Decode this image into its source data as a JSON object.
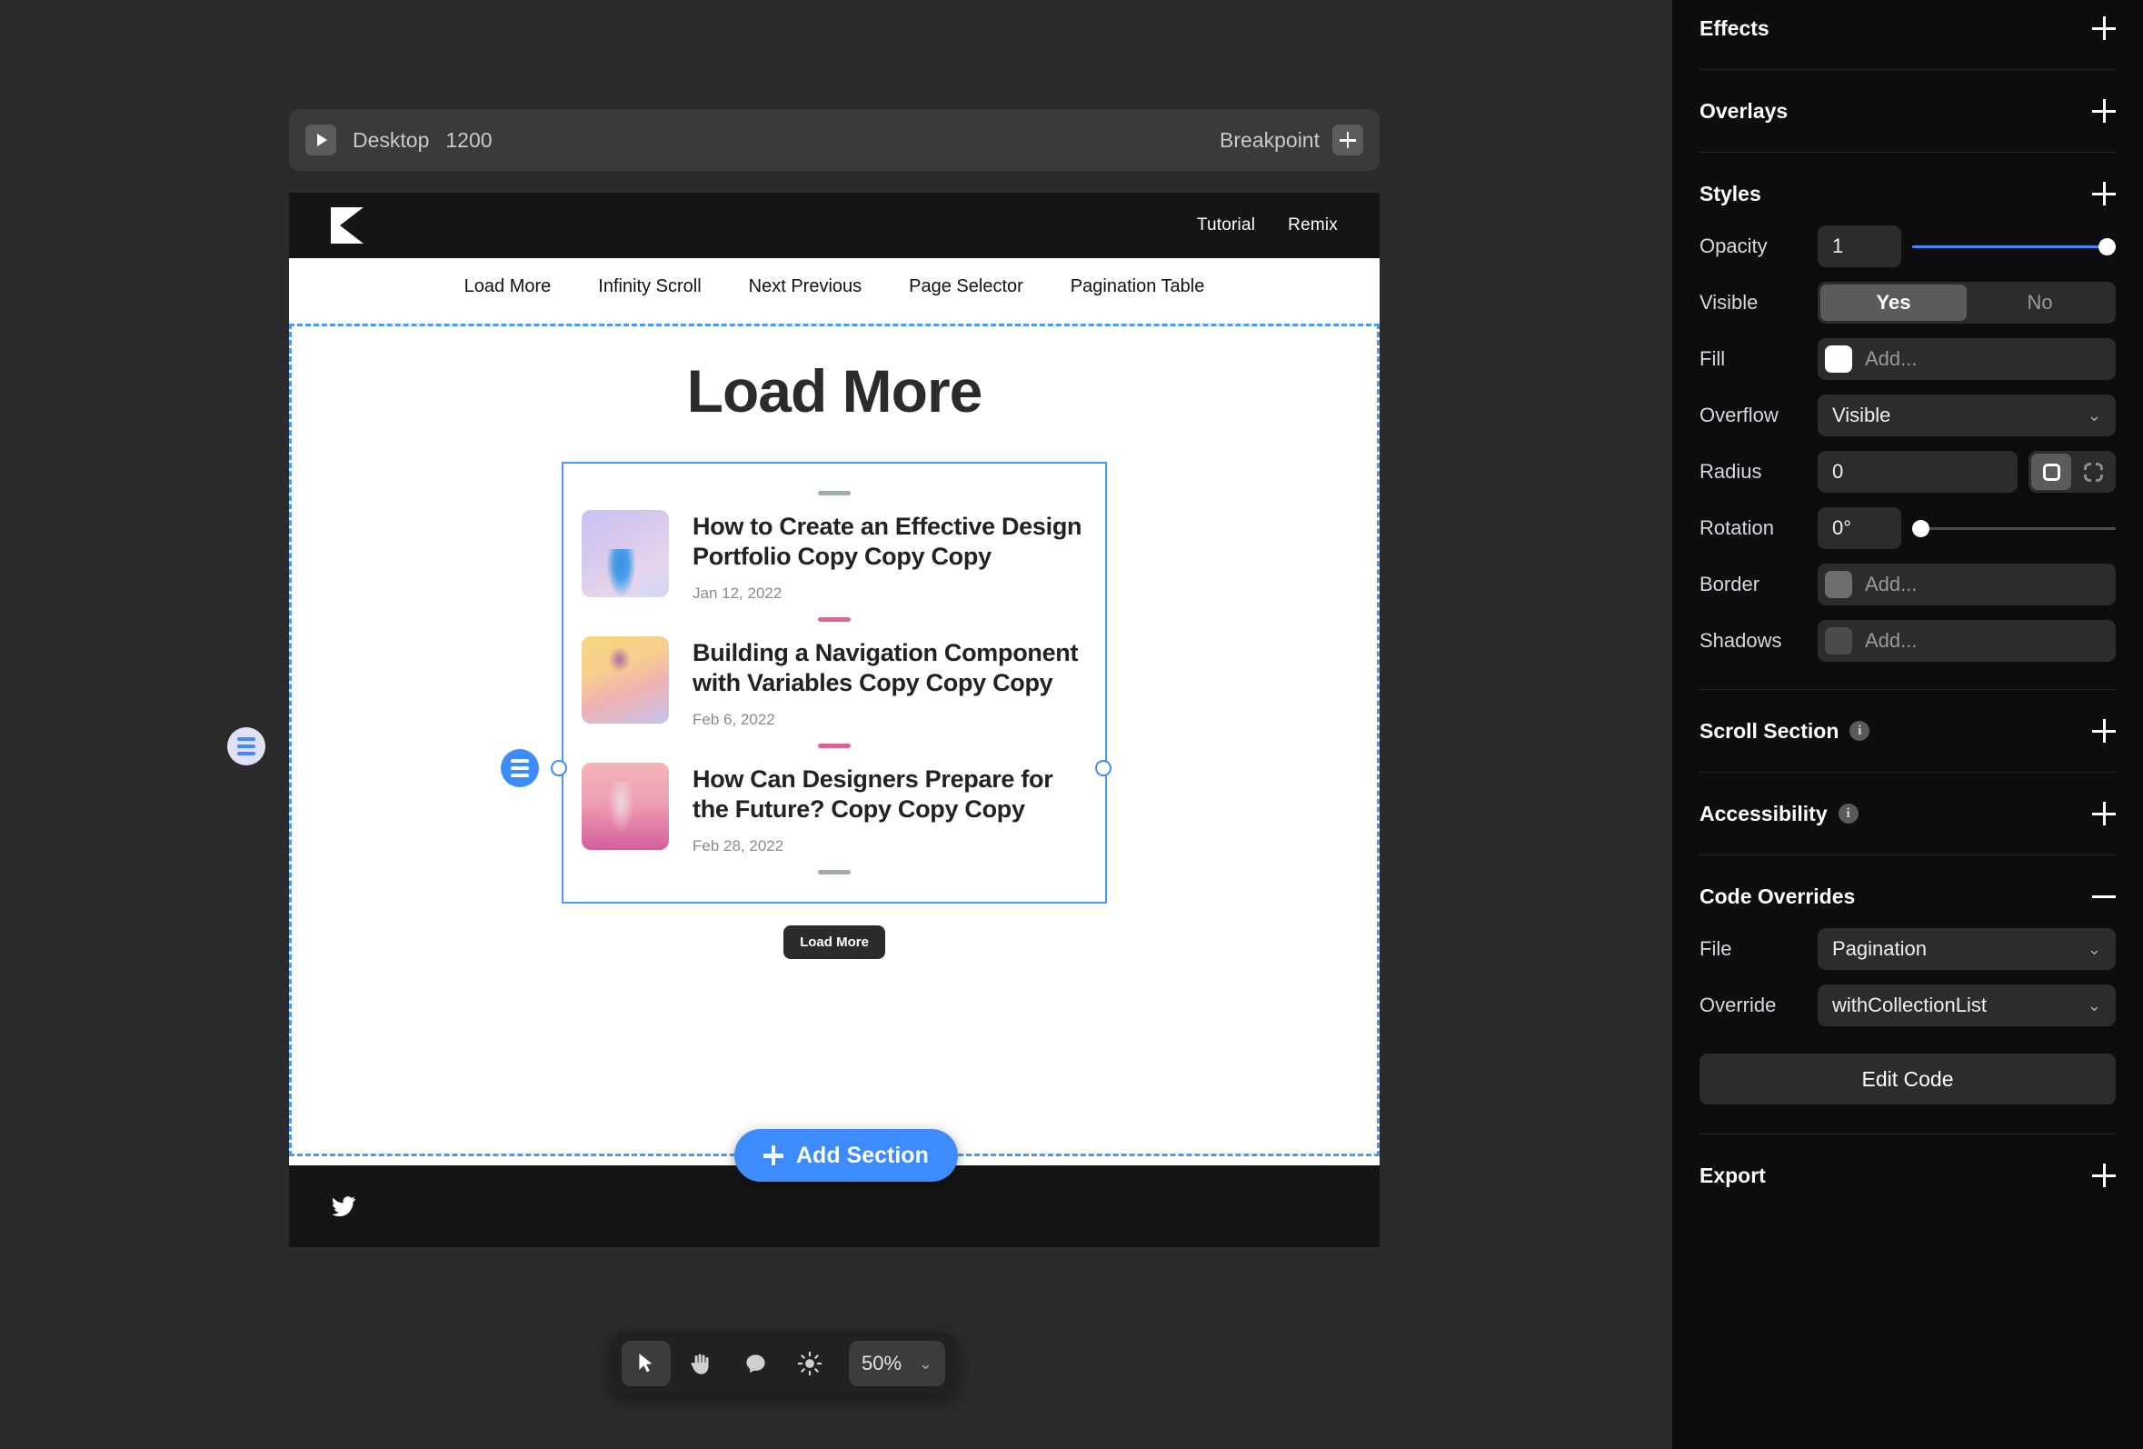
{
  "canvas": {
    "breakpoint_bar": {
      "play_icon": "play-icon",
      "name": "Desktop",
      "width": "1200",
      "breakpoint_label": "Breakpoint",
      "add_icon": "plus-icon"
    },
    "site": {
      "logo": "k-logo",
      "header_links": [
        "Tutorial",
        "Remix"
      ],
      "nav_links": [
        "Load More",
        "Infinity Scroll",
        "Next Previous",
        "Page Selector",
        "Pagination Table"
      ],
      "page_title": "Load More",
      "posts": [
        {
          "title": "How to Create an Effective Design Portfolio Copy Copy Copy",
          "date": "Jan 12, 2022",
          "thumb": "tree-blue-thumb"
        },
        {
          "title": "Building a Navigation Component with Variables Copy Copy Copy",
          "date": "Feb 6, 2022",
          "thumb": "flower-yellow-thumb"
        },
        {
          "title": "How Can Designers Prepare for the Future? Copy Copy Copy",
          "date": "Feb 28, 2022",
          "thumb": "tree-pink-thumb"
        }
      ],
      "load_more_label": "Load More",
      "footer_icon": "twitter-icon"
    },
    "add_section_label": "Add Section",
    "stack_badge_icon": "stack-icon",
    "selection_accent": "#3d8bfd"
  },
  "toolbar": {
    "tools": [
      {
        "icon": "cursor-icon",
        "active": true
      },
      {
        "icon": "hand-icon",
        "active": false
      },
      {
        "icon": "comment-icon",
        "active": false
      },
      {
        "icon": "brightness-icon",
        "active": false
      }
    ],
    "zoom_value": "50%",
    "zoom_chevron": "chevron-down-icon"
  },
  "panel": {
    "sections": {
      "effects": {
        "title": "Effects",
        "toggle": "plus"
      },
      "overlays": {
        "title": "Overlays",
        "toggle": "plus"
      },
      "styles": {
        "title": "Styles",
        "toggle": "plus"
      },
      "scroll_section": {
        "title": "Scroll Section",
        "toggle": "plus",
        "info": "i"
      },
      "accessibility": {
        "title": "Accessibility",
        "toggle": "plus",
        "info": "i"
      },
      "code_overrides": {
        "title": "Code Overrides",
        "toggle": "minus"
      },
      "export": {
        "title": "Export",
        "toggle": "plus"
      }
    },
    "styles": {
      "opacity": {
        "label": "Opacity",
        "value": "1",
        "slider_pct": 100
      },
      "visible": {
        "label": "Visible",
        "yes": "Yes",
        "no": "No",
        "selected": "Yes"
      },
      "fill": {
        "label": "Fill",
        "placeholder": "Add...",
        "color": "#ffffff"
      },
      "overflow": {
        "label": "Overflow",
        "value": "Visible"
      },
      "radius": {
        "label": "Radius",
        "value": "0",
        "mode": "all"
      },
      "rotation": {
        "label": "Rotation",
        "value": "0°",
        "slider_pct": 0
      },
      "border": {
        "label": "Border",
        "placeholder": "Add..."
      },
      "shadows": {
        "label": "Shadows",
        "placeholder": "Add..."
      }
    },
    "code_overrides": {
      "file": {
        "label": "File",
        "value": "Pagination"
      },
      "override": {
        "label": "Override",
        "value": "withCollectionList"
      },
      "edit_code_label": "Edit Code"
    }
  }
}
